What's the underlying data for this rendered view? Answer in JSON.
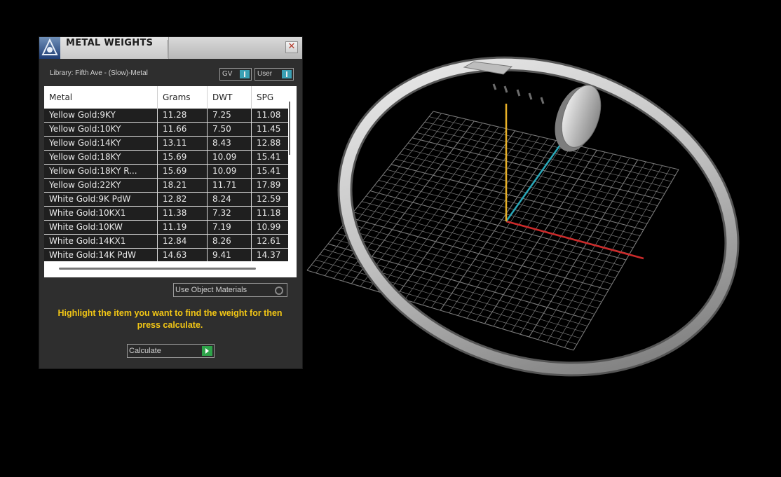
{
  "panel": {
    "title": "METAL WEIGHTS",
    "close_glyph": "✕",
    "library_label": "Library: Fifth Ave - (Slow)-Metal",
    "toggles": [
      {
        "label": "GV",
        "icon": "toggle-knob-icon"
      },
      {
        "label": "User",
        "icon": "toggle-knob-icon"
      }
    ],
    "table": {
      "headers": [
        "Metal",
        "Grams",
        "DWT",
        "SPG"
      ],
      "rows": [
        [
          "Yellow Gold:9KY",
          "11.28",
          "7.25",
          "11.08"
        ],
        [
          "Yellow Gold:10KY",
          "11.66",
          "7.50",
          "11.45"
        ],
        [
          "Yellow Gold:14KY",
          "13.11",
          "8.43",
          "12.88"
        ],
        [
          "Yellow Gold:18KY",
          "15.69",
          "10.09",
          "15.41"
        ],
        [
          "Yellow Gold:18KY R...",
          "15.69",
          "10.09",
          "15.41"
        ],
        [
          "Yellow Gold:22KY",
          "18.21",
          "11.71",
          "17.89"
        ],
        [
          "White Gold:9K PdW",
          "12.82",
          "8.24",
          "12.59"
        ],
        [
          "White Gold:10KX1",
          "11.38",
          "7.32",
          "11.18"
        ],
        [
          "White Gold:10KW",
          "11.19",
          "7.19",
          "10.99"
        ],
        [
          "White Gold:14KX1",
          "12.84",
          "8.26",
          "12.61"
        ],
        [
          "White Gold:14K PdW",
          "14.63",
          "9.41",
          "14.37"
        ]
      ]
    },
    "use_object_materials_label": "Use Object Materials",
    "hint_text": "Highlight the item you want to find the weight for then press calculate.",
    "calculate_label": "Calculate"
  },
  "colors": {
    "hint": "#f3c715",
    "toggle_accent": "#3aa0b4",
    "calculate_accent": "#2ea34a",
    "axis_x": "#cc2a2a",
    "axis_y": "#e8b027",
    "axis_z": "#2aa7b8"
  },
  "icons": {
    "app": "rhino-app-icon",
    "close": "close-icon",
    "radio": "radio-icon",
    "go": "play-arrow-icon"
  }
}
